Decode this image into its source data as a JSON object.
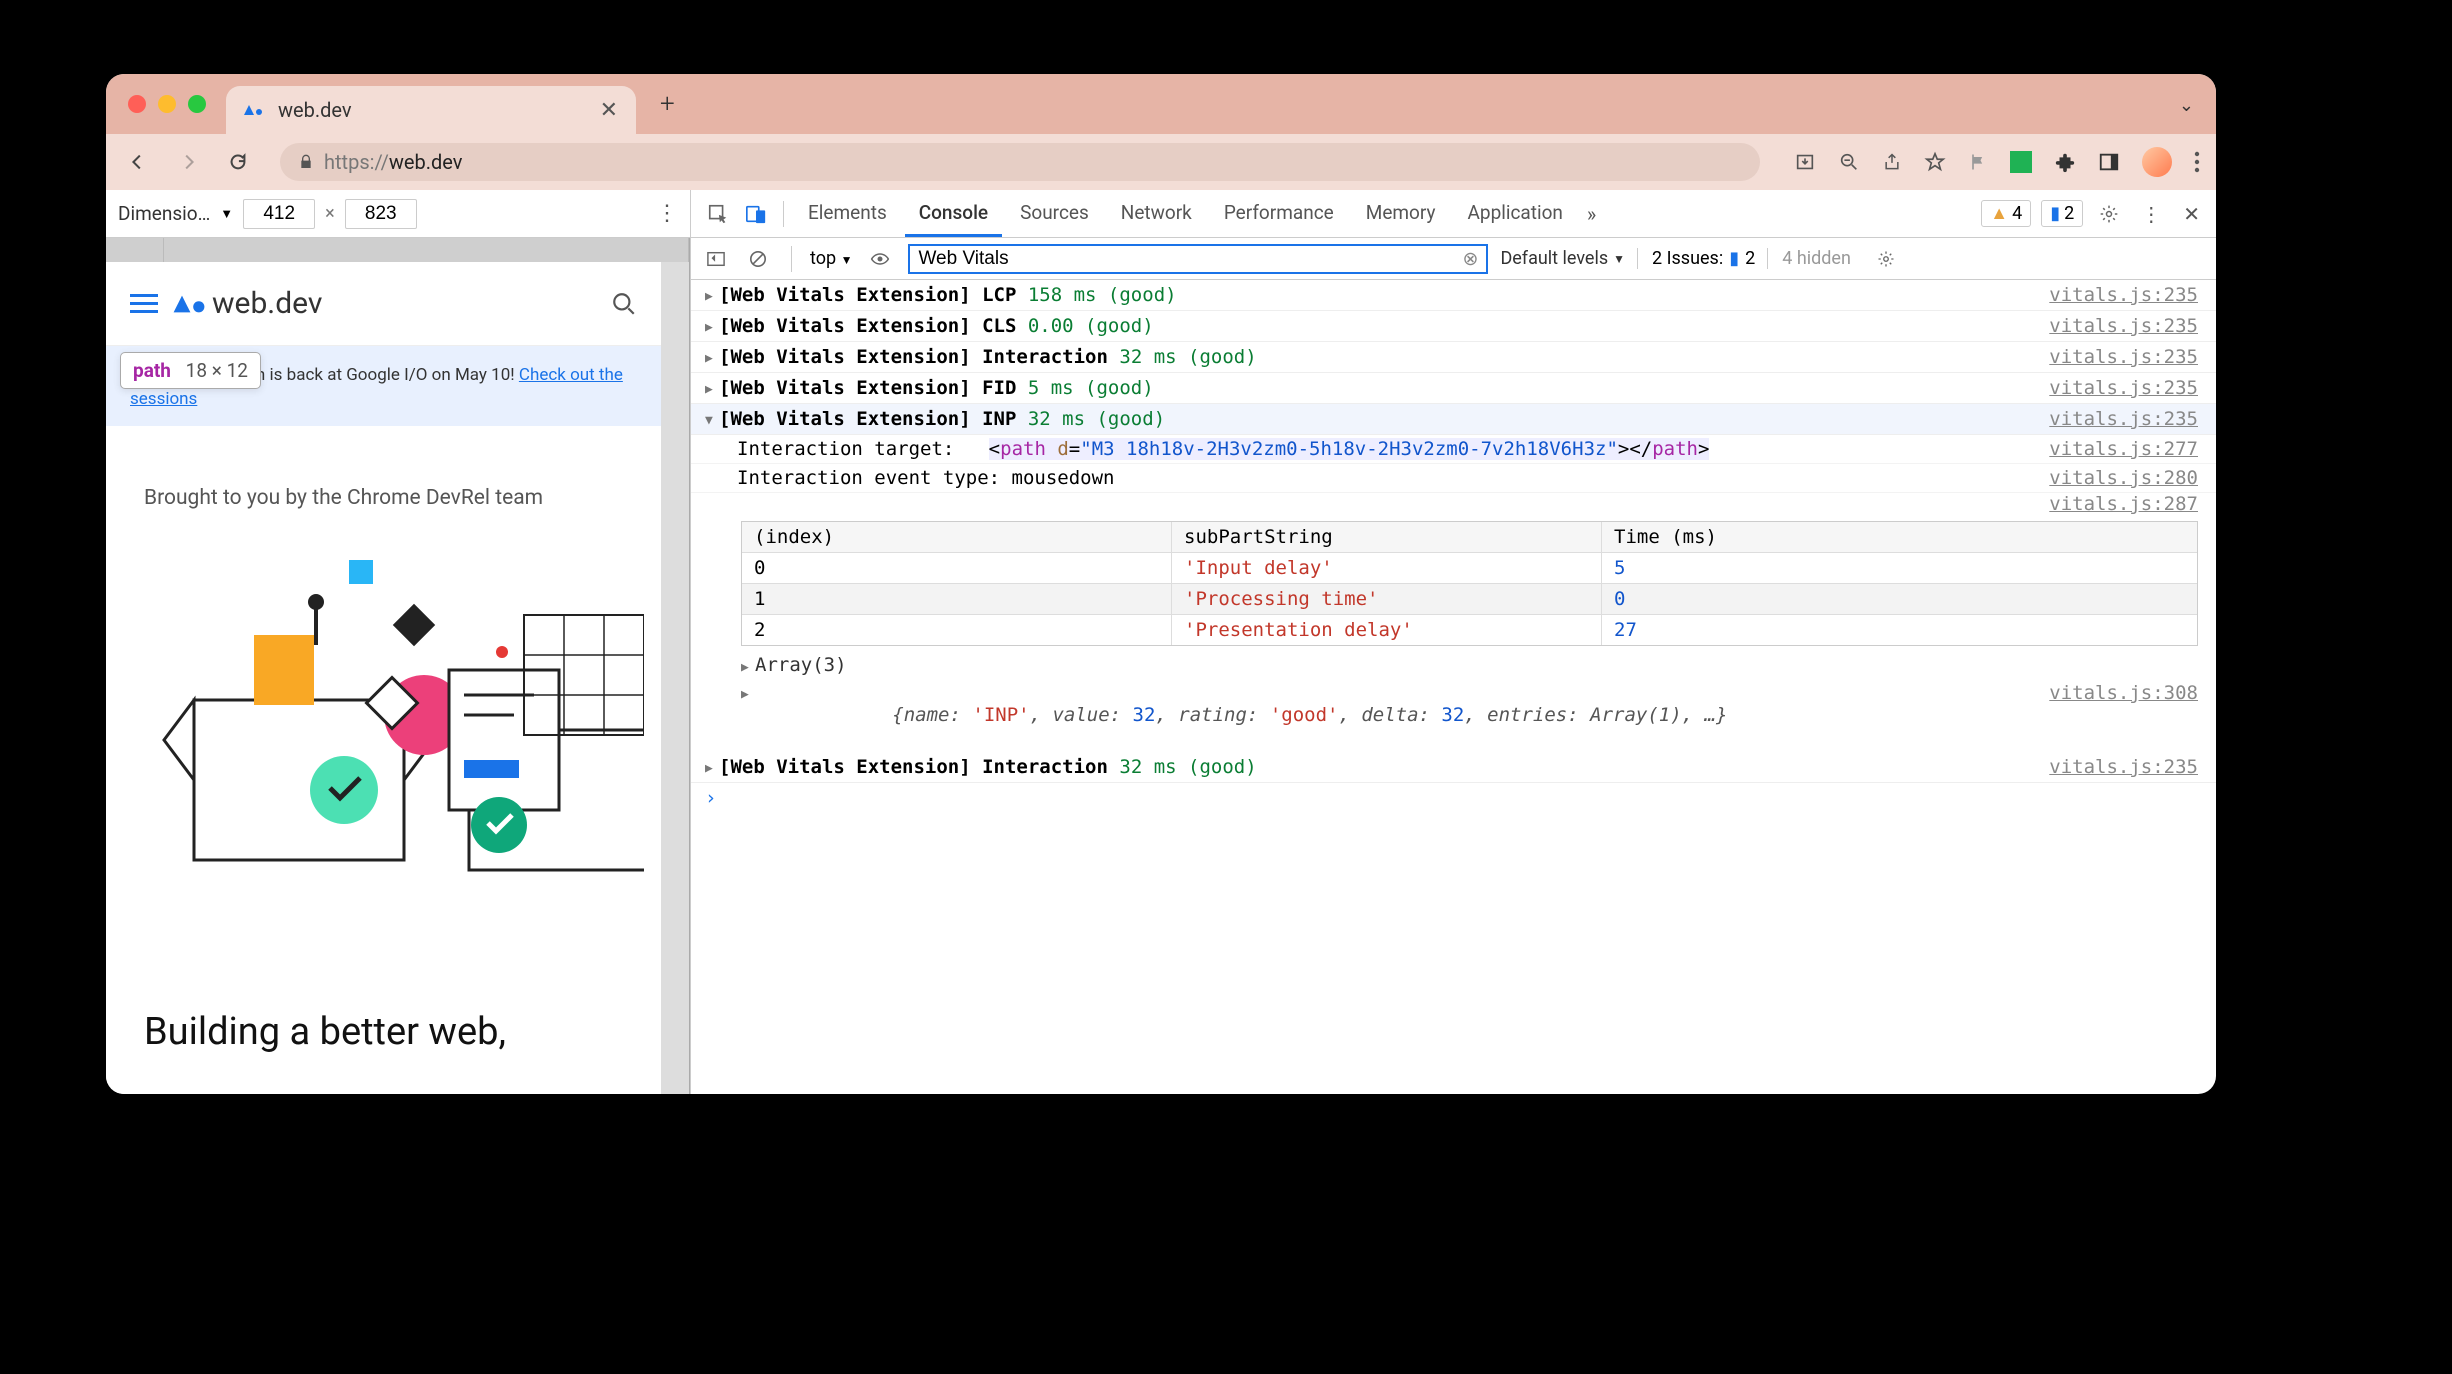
{
  "browser": {
    "tab_title": "web.dev",
    "url_display": "https://web.dev"
  },
  "device_toolbar": {
    "label": "Dimensio…",
    "width": "412",
    "height": "823"
  },
  "preview": {
    "site_name": "web.dev",
    "tooltip_tag": "path",
    "tooltip_size": "18 × 12",
    "banner_prefix": "The Chrome team is back at Google I/O on May 10! ",
    "banner_link": "Check out the sessions",
    "brought": "Brought to you by the Chrome DevRel team",
    "headline": "Building a better web,"
  },
  "devtools": {
    "tabs": [
      "Elements",
      "Console",
      "Sources",
      "Network",
      "Performance",
      "Memory",
      "Application"
    ],
    "warn_count": "4",
    "info_count": "2",
    "filter_value": "Web Vitals",
    "context": "top",
    "levels": "Default levels",
    "issues_label": "2 Issues:",
    "issues_count": "2",
    "hidden": "4 hidden"
  },
  "logs": [
    {
      "prefix": "[Web Vitals Extension] LCP ",
      "value": "158 ms (good)",
      "src": "vitals.js:235"
    },
    {
      "prefix": "[Web Vitals Extension] CLS ",
      "value": "0.00 (good)",
      "src": "vitals.js:235"
    },
    {
      "prefix": "[Web Vitals Extension] Interaction ",
      "value": "32 ms (good)",
      "src": "vitals.js:235"
    },
    {
      "prefix": "[Web Vitals Extension] FID ",
      "value": "5 ms (good)",
      "src": "vitals.js:235"
    }
  ],
  "expanded": {
    "prefix": "[Web Vitals Extension] INP ",
    "value": "32 ms (good)",
    "src": "vitals.js:235",
    "target_label": "Interaction target:",
    "target_tag": "path",
    "target_attr_name": "d",
    "target_attr_val": "\"M3 18h18v-2H3v2zm0-5h18v-2H3v2zm0-7v2h18V6H3z\"",
    "target_src": "vitals.js:277",
    "event_label": "Interaction event type: ",
    "event_type": "mousedown",
    "event_src": "vitals.js:280",
    "table_src": "vitals.js:287",
    "table": {
      "headers": [
        "(index)",
        "subPartString",
        "Time (ms)"
      ],
      "rows": [
        {
          "idx": "0",
          "s": "'Input delay'",
          "t": "5"
        },
        {
          "idx": "1",
          "s": "'Processing time'",
          "t": "0"
        },
        {
          "idx": "2",
          "s": "'Presentation delay'",
          "t": "27"
        }
      ]
    },
    "array_summary": "Array(3)",
    "obj_summary": "{name: 'INP', value: 32, rating: 'good', delta: 32, entries: Array(1), …}",
    "obj_src": "vitals.js:308"
  },
  "last_log": {
    "prefix": "[Web Vitals Extension] Interaction ",
    "value": "32 ms (good)",
    "src": "vitals.js:235"
  },
  "obj_parts": {
    "name_k": "name: ",
    "name_v": "'INP'",
    "value_k": ", value: ",
    "value_v": "32",
    "rating_k": ", rating: ",
    "rating_v": "'good'",
    "delta_k": ", delta: ",
    "delta_v": "32",
    "entries_k": ", entries: ",
    "entries_v": "Array(1)",
    "tail": ", …}"
  }
}
